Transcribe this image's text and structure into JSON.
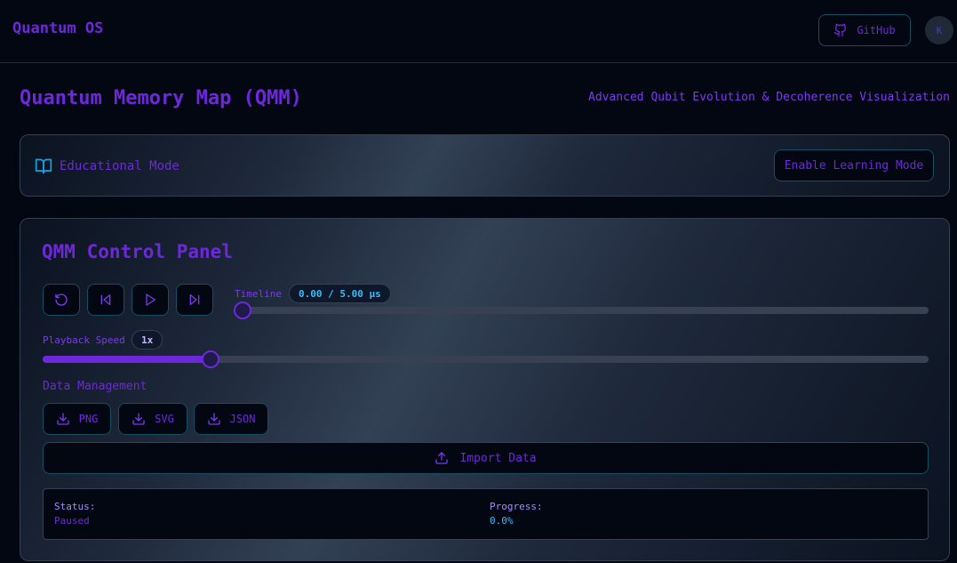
{
  "nav": {
    "brand": "Quantum OS",
    "github_label": "GitHub",
    "github_icon": "github-icon",
    "avatar_initial": "K"
  },
  "page": {
    "title": "Quantum Memory Map (QMM)",
    "subtitle": "Advanced Qubit Evolution & Decoherence Visualization"
  },
  "education": {
    "icon": "book-open-icon",
    "label": "Educational Mode",
    "button_label": "Enable Learning Mode"
  },
  "control_panel": {
    "title": "QMM Control Panel",
    "controls": [
      {
        "name": "reset-button",
        "icon": "rotate-ccw-icon"
      },
      {
        "name": "step-back-button",
        "icon": "skip-back-icon"
      },
      {
        "name": "play-button",
        "icon": "play-icon"
      },
      {
        "name": "step-forward-button",
        "icon": "skip-forward-icon"
      }
    ],
    "timeline": {
      "label": "Timeline",
      "value_text": "0.00 / 5.00 μs",
      "current": 0.0,
      "max": 5.0
    },
    "playback_speed": {
      "label": "Playback Speed",
      "value_text": "1x",
      "fraction": 0.19
    },
    "data_management": {
      "label": "Data Management",
      "exports": [
        "PNG",
        "SVG",
        "JSON"
      ],
      "import_label": "Import Data"
    },
    "status": {
      "status_label": "Status:",
      "status_value": "Paused",
      "progress_label": "Progress:",
      "progress_value": "0.0%"
    }
  },
  "colors": {
    "background": "#030712",
    "accent": "#6d28d9",
    "cyan": "#38bdf8",
    "border": "#164e63"
  }
}
